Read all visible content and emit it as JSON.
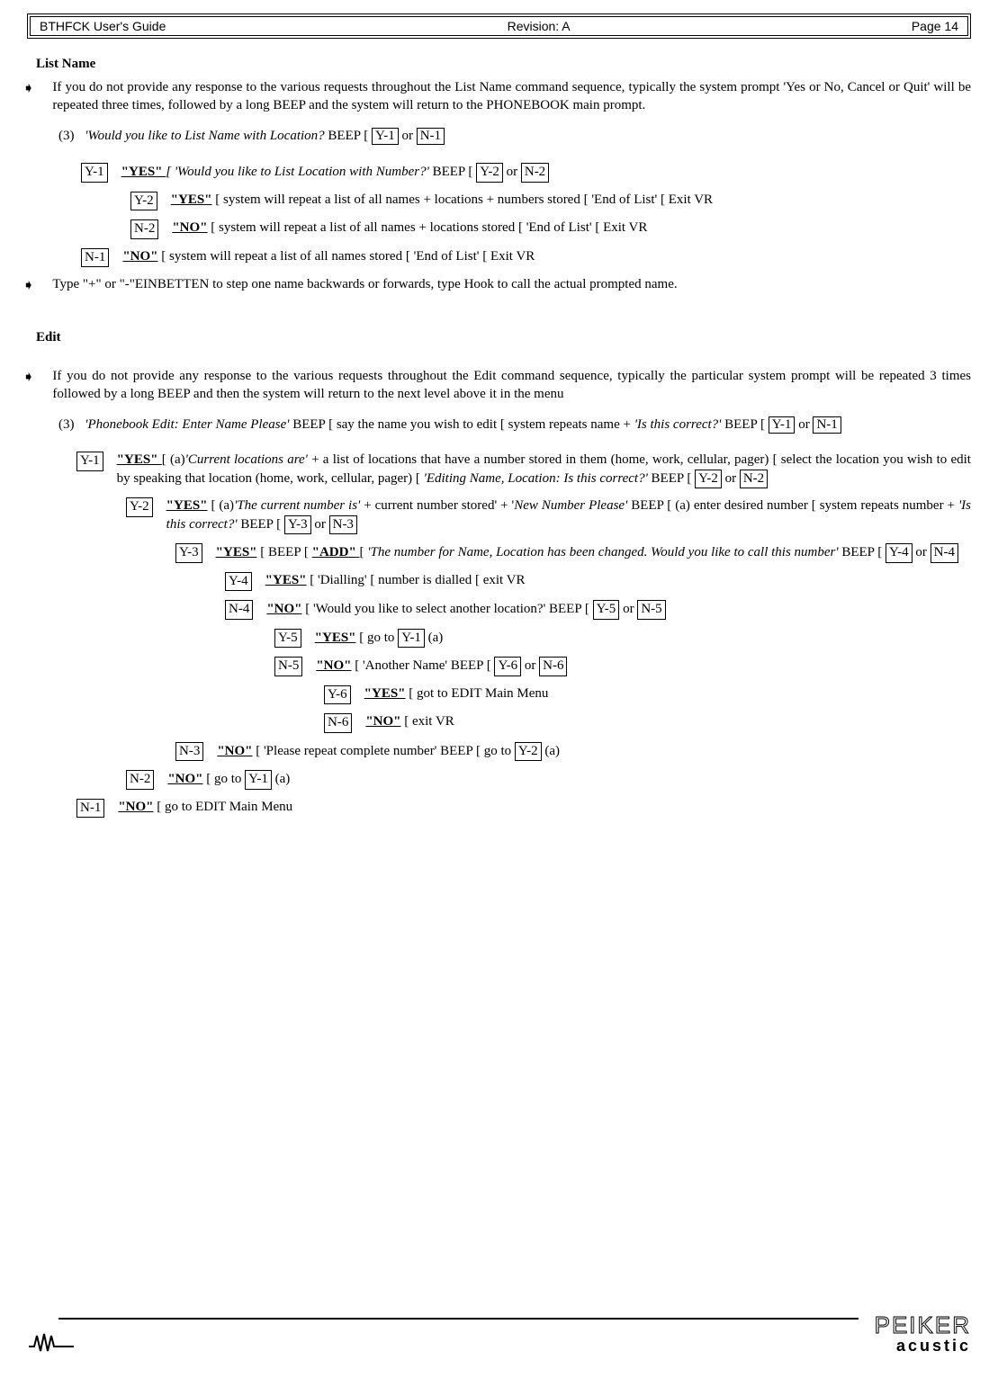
{
  "header": {
    "left": "BTHFCK  User's Guide",
    "center": "Revision: A",
    "right": "Page 14"
  },
  "listname": {
    "title": "List Name",
    "arrow1": "If you do not provide any response to the various requests throughout the List Name command sequence, typically the system prompt 'Yes or No, Cancel or Quit' will be repeated three times, followed by a long BEEP and the system will return to the PHONEBOOK main prompt.",
    "step3_prefix": "(3)",
    "step3_italic": "'Would you like to List Name with Location?",
    "step3_suffix": " BEEP [ ",
    "step3_or": " or ",
    "y1_label": "Y-1",
    "y1_yes": "\"YES\" ",
    "y1_text1": "[ 'Would you like to List Location with Number?'",
    "y1_text2": "  BEEP [ ",
    "y1_or": " or ",
    "y2_label": "Y-2",
    "y2_yes": " \"YES\"",
    "y2_text": " [ system will repeat a list of all names + locations + numbers stored [ 'End of List' [ Exit VR",
    "n2_top_label": "N-2",
    "n2_top_no": "\"NO\"",
    "n2_top_text": " [ system will repeat a list of all names + locations stored [ 'End of List' [ Exit VR",
    "n1_label": "N-1",
    "n1_no": "\"NO\"",
    "n1_text": " [ system will repeat a list of all names stored [ 'End of List' [ Exit VR",
    "arrow2": "Type \"+\" or \"-\"EINBETTEN to step one name backwards or forwards, type Hook to call the actual prompted name."
  },
  "edit": {
    "title": "Edit",
    "arrow1": "If you do not provide any response to the various requests throughout the Edit command sequence, typically the particular system prompt will be repeated 3 times followed by a long BEEP and then the system will return to the next level above it in the menu",
    "step3_prefix": "(3)",
    "step3_italic1": "'Phonebook Edit: Enter Name Please'",
    "step3_mid": " BEEP [ say the name you wish to edit [ system repeats name + ",
    "step3_italic2": "'Is this correct?'",
    "step3_end": " BEEP [ ",
    "step3_or": " or ",
    "y1_label": "Y-1",
    "y1_yes": " \"YES\" ",
    "y1_a": "[ (a)",
    "y1_italic": "'Current locations are'",
    "y1_text": " + a list of locations that have a number stored in them (home, work, cellular, pager) [ select the location you wish to edit by speaking that location (home, work, cellular, pager) [ ",
    "y1_italic2": "'Editing Name, Location: Is this correct?'",
    "y1_end": " BEEP [ ",
    "y1_or": " or ",
    "y2_label": "Y-2",
    "y2_yes": "\"YES\"",
    "y2_a": " [ (a)",
    "y2_italic1": "'The current number is'",
    "y2_mid": " + current number stored' + '",
    "y2_italic2": "New Number Please'",
    "y2_text": " BEEP [ (a) enter desired number [ system repeats number + ",
    "y2_italic3": "'Is this correct?'",
    "y2_end": " BEEP [ ",
    "y2_or": " or ",
    "y3_label": "Y-3",
    "y3_yes": "\"YES\"",
    "y3_beep": " [ BEEP [ ",
    "y3_add": "\"ADD\" ",
    "y3_bracket": " [ ",
    "y3_italic": "'The number for Name, Location has been changed.  Would you like to call this number'",
    "y3_end": " BEEP [ ",
    "y3_or": " or ",
    "y4_label": "Y-4",
    "y4_yes": "\"YES\"",
    "y4_text": " [ 'Dialling' [ number is dialled [ exit VR",
    "n4_label": "N-4",
    "n4_no": "\"NO\"",
    "n4_text": " [ 'Would you like to select another location?' BEEP [ ",
    "n4_or": " or ",
    "y5_label": "Y-5",
    "y5_yes": "\"YES\"",
    "y5_text": " [ go to ",
    "y5_a": " (a)",
    "n5_label": "N-5",
    "n5_no": "\"NO\"",
    "n5_text": " [ 'Another Name' BEEP [ ",
    "n5_or": " or ",
    "y6_label": "Y-6",
    "y6_yes": "\"YES\"",
    "y6_text": " [ got to EDIT Main Menu",
    "n6_label": "N-6",
    "n6_no": "\"NO\"",
    "n6_text": " [ exit VR",
    "n3_label": "N-3",
    "n3_no": "\"NO\"",
    "n3_text": " [ 'Please repeat complete number' BEEP [ go to ",
    "n3_a": " (a)",
    "n2_label": "N-2",
    "n2_no": "\"NO\"",
    "n2_text": " [ go to ",
    "n2_a": " (a)",
    "n1_label": "N-1",
    "n1_no": "\"NO\"",
    "n1_text": " [ go to EDIT Main Menu"
  },
  "boxes": {
    "y1": "Y-1",
    "n1": "N-1",
    "y2": "Y-2",
    "n2": "N-2",
    "y3": "Y-3",
    "n3": "N-3",
    "y4": "Y-4",
    "n4": "N-4",
    "y5": "Y-5",
    "n5": "N-5",
    "y6": "Y-6",
    "n6": "N-6"
  },
  "footer": {
    "brand": "PEIKER",
    "sub": "acustic"
  }
}
